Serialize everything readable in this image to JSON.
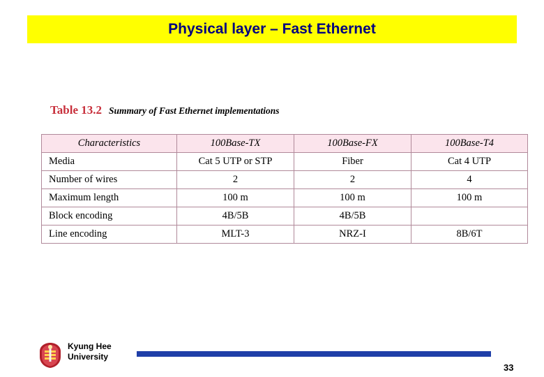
{
  "slide": {
    "title": "Physical layer – Fast Ethernet",
    "caption_label": "Table 13.2",
    "caption_title": "Summary of Fast Ethernet implementations"
  },
  "table": {
    "headers": [
      "Characteristics",
      "100Base-TX",
      "100Base-FX",
      "100Base-T4"
    ],
    "rows": [
      {
        "label": "Media",
        "cells": [
          "Cat 5 UTP or STP",
          "Fiber",
          "Cat 4 UTP"
        ]
      },
      {
        "label": "Number of wires",
        "cells": [
          "2",
          "2",
          "4"
        ]
      },
      {
        "label": "Maximum length",
        "cells": [
          "100 m",
          "100 m",
          "100 m"
        ]
      },
      {
        "label": "Block encoding",
        "cells": [
          "4B/5B",
          "4B/5B",
          ""
        ]
      },
      {
        "label": "Line encoding",
        "cells": [
          "MLT-3",
          "NRZ-I",
          "8B/6T"
        ]
      }
    ]
  },
  "footer": {
    "university_line1": "Kyung Hee",
    "university_line2": "University",
    "page_number": "33"
  },
  "colors": {
    "banner": "#ffff00",
    "title_text": "#000080",
    "caption_label": "#c8303c",
    "table_header_bg": "#fbe4ec",
    "table_border": "#b0899a",
    "footer_bar": "#1f3fa8"
  }
}
